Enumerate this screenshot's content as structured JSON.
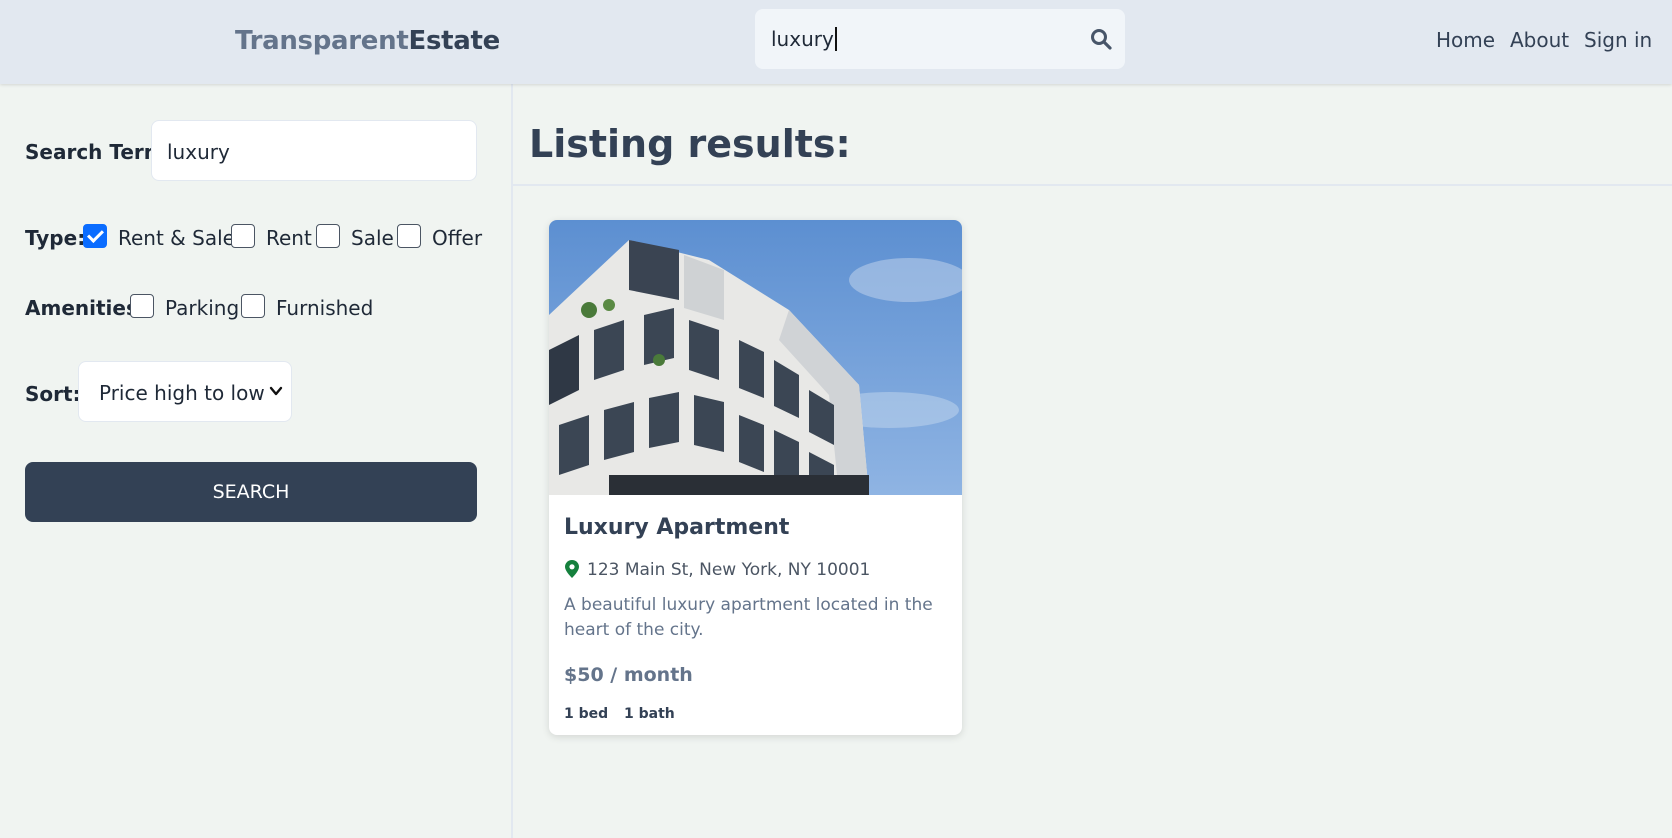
{
  "header": {
    "logo_part1": "Transparent",
    "logo_part2": "Estate",
    "search_value": "luxury",
    "search_icon": "search-icon",
    "nav": [
      "Home",
      "About",
      "Sign in"
    ]
  },
  "sidebar": {
    "search_term_label": "Search Term:",
    "search_term_value": "luxury",
    "type_label": "Type:",
    "type_options": [
      {
        "label": "Rent & Sale",
        "checked": true
      },
      {
        "label": "Rent",
        "checked": false
      },
      {
        "label": "Sale",
        "checked": false
      },
      {
        "label": "Offer",
        "checked": false
      }
    ],
    "amenities_label": "Amenities:",
    "amenity_options": [
      {
        "label": "Parking",
        "checked": false
      },
      {
        "label": "Furnished",
        "checked": false
      }
    ],
    "sort_label": "Sort:",
    "sort_value": "Price high to low",
    "search_button": "SEARCH"
  },
  "main": {
    "results_title": "Listing results:",
    "listings": [
      {
        "title": "Luxury Apartment",
        "address": "123 Main St, New York, NY 10001",
        "description": "A beautiful luxury apartment located in the heart of the city.",
        "price": "$50 / month",
        "beds": "1 bed",
        "baths": "1 bath"
      }
    ]
  },
  "colors": {
    "header_bg": "#e2e8f0",
    "page_bg": "#f0f4f1",
    "button_bg": "#334155",
    "checkbox_accent": "#0a6cff",
    "pin_green": "#15803d"
  }
}
